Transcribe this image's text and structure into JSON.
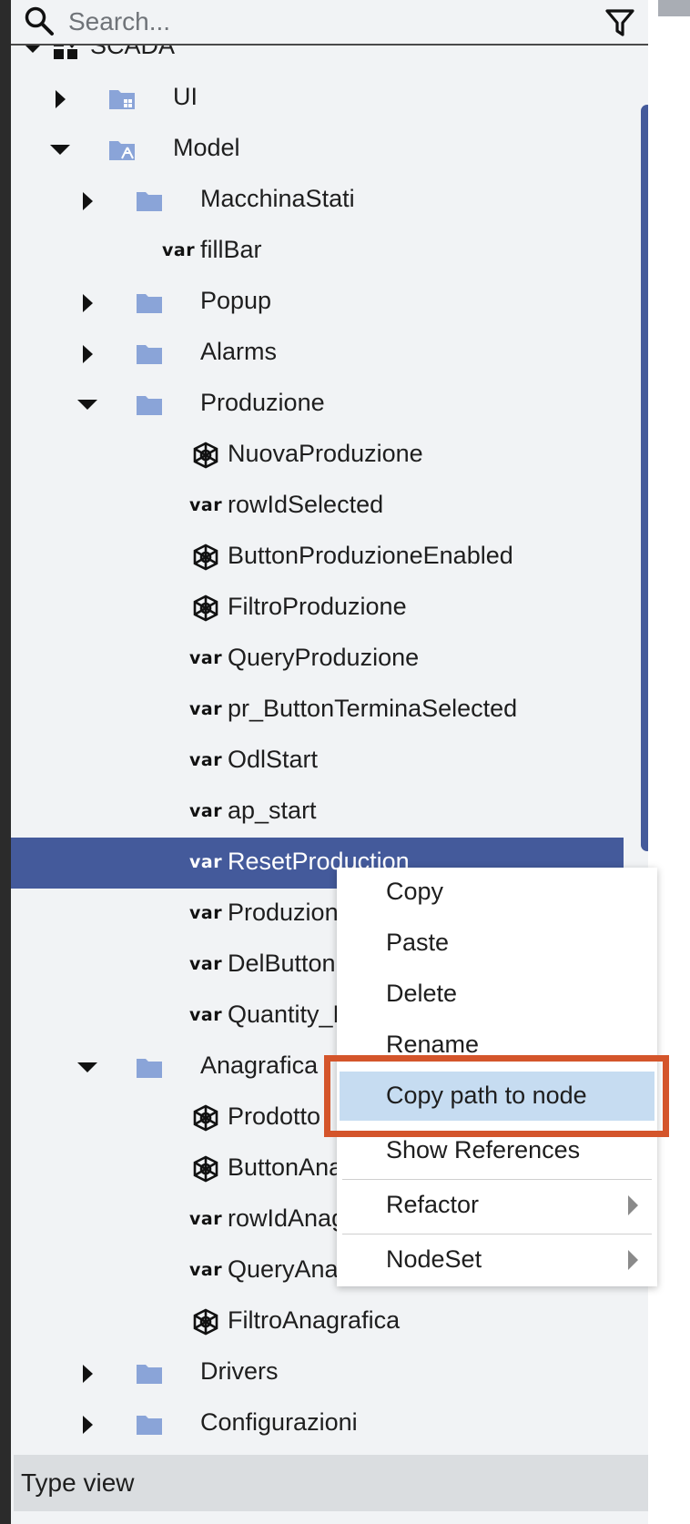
{
  "search": {
    "placeholder": "Search..."
  },
  "tree": {
    "items": [
      {
        "label": "SCADA"
      },
      {
        "label": "UI"
      },
      {
        "label": "Model"
      },
      {
        "label": "MacchinaStati"
      },
      {
        "label": "fillBar",
        "var": "var"
      },
      {
        "label": "Popup"
      },
      {
        "label": "Alarms"
      },
      {
        "label": "Produzione"
      },
      {
        "label": "NuovaProduzione"
      },
      {
        "label": "rowIdSelected",
        "var": "var"
      },
      {
        "label": "ButtonProduzioneEnabled"
      },
      {
        "label": "FiltroProduzione"
      },
      {
        "label": "QueryProduzione",
        "var": "var"
      },
      {
        "label": "pr_ButtonTerminaSelected",
        "var": "var"
      },
      {
        "label": "OdlStart",
        "var": "var"
      },
      {
        "label": "ap_start",
        "var": "var"
      },
      {
        "label": "ResetProduction",
        "var": "var"
      },
      {
        "label": "ProduzioneInCorso",
        "var": "var"
      },
      {
        "label": "DelButton",
        "var": "var"
      },
      {
        "label": "Quantity_Extra",
        "var": "var"
      },
      {
        "label": "Anagrafica"
      },
      {
        "label": "Prodotto"
      },
      {
        "label": "ButtonAnagrafica"
      },
      {
        "label": "rowIdAnagrafica",
        "var": "var"
      },
      {
        "label": "QueryAnagrafica",
        "var": "var"
      },
      {
        "label": "FiltroAnagrafica"
      },
      {
        "label": "Drivers"
      },
      {
        "label": "Configurazioni"
      }
    ]
  },
  "context_menu": {
    "items": [
      {
        "label": "Copy"
      },
      {
        "label": "Paste"
      },
      {
        "label": "Delete"
      },
      {
        "label": "Rename"
      },
      {
        "label": "Copy path to node"
      },
      {
        "label": "Show References"
      },
      {
        "label": "Refactor"
      },
      {
        "label": "NodeSet"
      }
    ]
  },
  "footer": {
    "type_view_label": "Type view"
  },
  "colors": {
    "selection": "#445a9b",
    "menu_highlight": "#c6dcf1",
    "callout": "#d4552b",
    "folder": "#8aa4d8"
  }
}
